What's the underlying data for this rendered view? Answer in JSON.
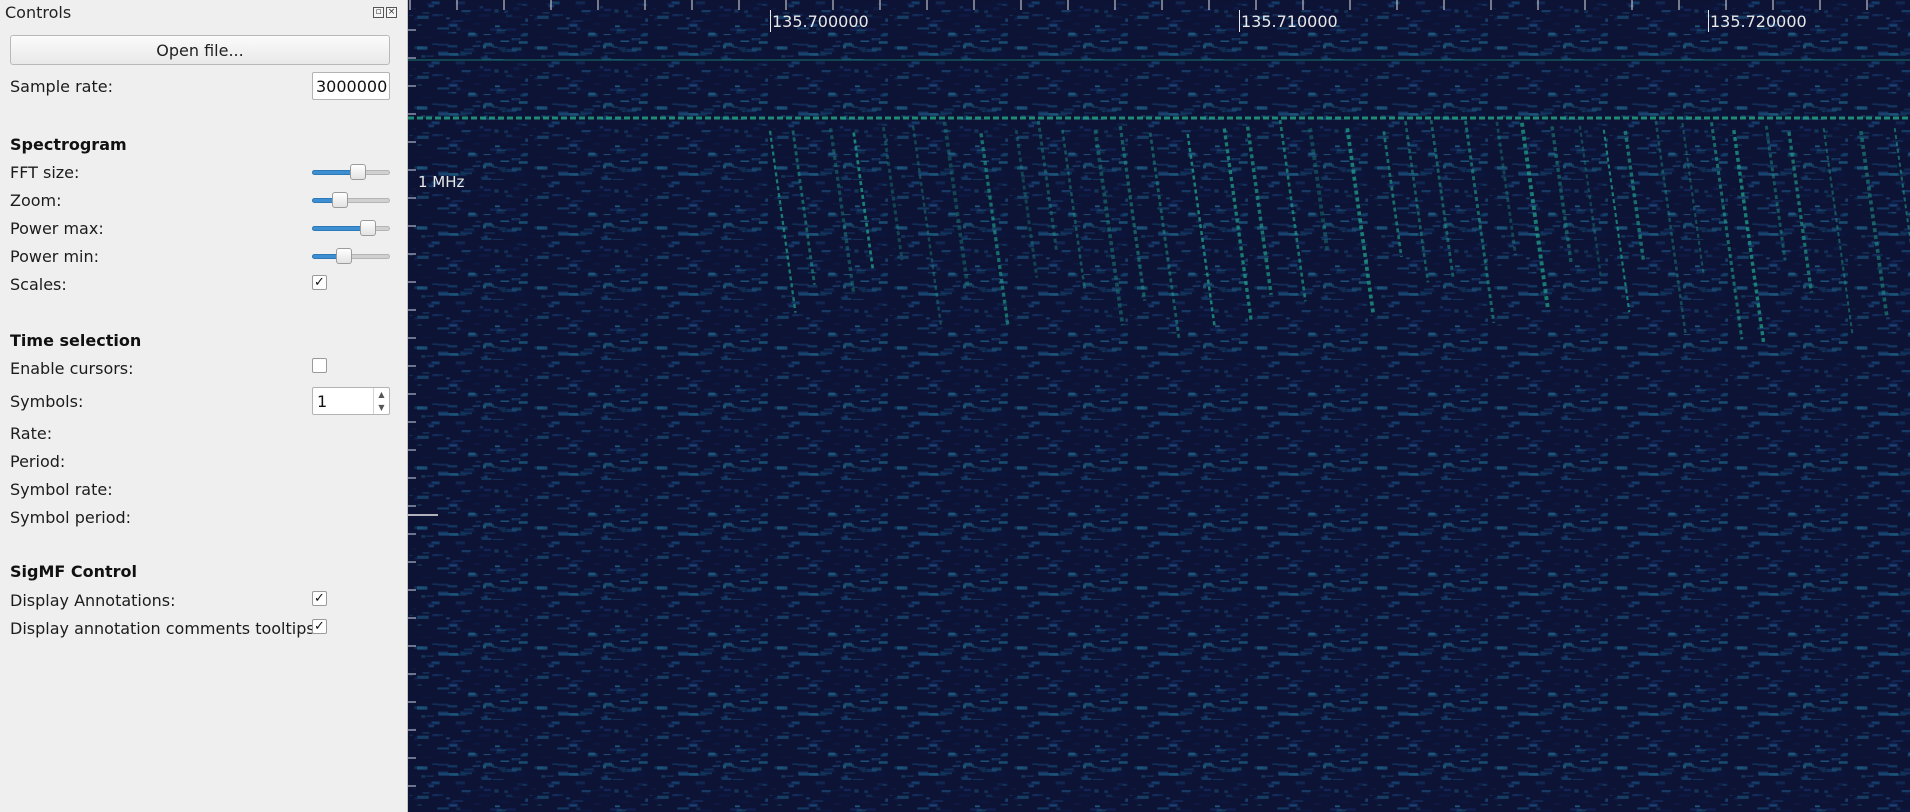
{
  "dock": {
    "title": "Controls"
  },
  "file": {
    "open_label": "Open file...",
    "sample_rate_label": "Sample rate:",
    "sample_rate_value": "3000000"
  },
  "spectrogram": {
    "heading": "Spectrogram",
    "fft_size_label": "FFT size:",
    "fft_size_level": 0.62,
    "zoom_label": "Zoom:",
    "zoom_level": 0.32,
    "power_max_label": "Power max:",
    "power_max_level": 0.78,
    "power_min_label": "Power min:",
    "power_min_level": 0.38,
    "scales_label": "Scales:",
    "scales_checked": true
  },
  "time_selection": {
    "heading": "Time selection",
    "enable_cursors_label": "Enable cursors:",
    "enable_cursors_checked": false,
    "symbols_label": "Symbols:",
    "symbols_value": "1",
    "rate_label": "Rate:",
    "period_label": "Period:",
    "symbol_rate_label": "Symbol rate:",
    "symbol_period_label": "Symbol period:"
  },
  "sigmf": {
    "heading": "SigMF Control",
    "display_annotations_label": "Display Annotations:",
    "display_annotations_checked": true,
    "display_tooltips_label": "Display annotation comments tooltips:",
    "display_tooltips_checked": true
  },
  "plot": {
    "freq_labels": [
      "135.700000",
      "135.710000",
      "135.720000"
    ],
    "scale_label": "1 MHz",
    "colors": {
      "background": "#0c1335",
      "signal": "#1f9e86",
      "noise": "#1a4a78"
    }
  }
}
